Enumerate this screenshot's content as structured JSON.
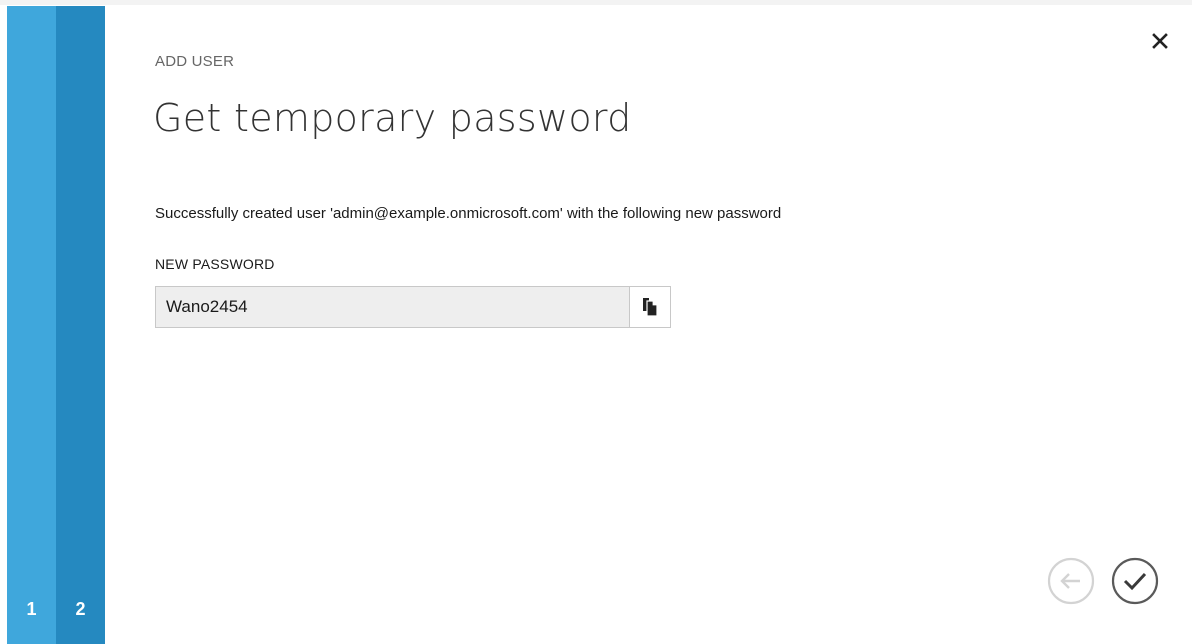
{
  "wizard": {
    "section_label": "ADD USER",
    "title": "Get temporary password",
    "message": "Successfully created user 'admin@example.onmicrosoft.com' with the following new password"
  },
  "password_field": {
    "label": "NEW PASSWORD",
    "value": "Wano2454"
  },
  "steps": [
    {
      "label": "1",
      "color": "#3fa7dc"
    },
    {
      "label": "2",
      "color": "#2589c0"
    }
  ],
  "icons": {
    "close": "close-icon",
    "copy": "copy-icon",
    "back": "back-arrow-icon",
    "finish": "checkmark-icon"
  },
  "colors": {
    "step1": "#3fa7dc",
    "step2": "#2589c0",
    "field_background": "#eeeeee",
    "disabled_button": "#d0d0d0",
    "active_button": "#555555"
  }
}
